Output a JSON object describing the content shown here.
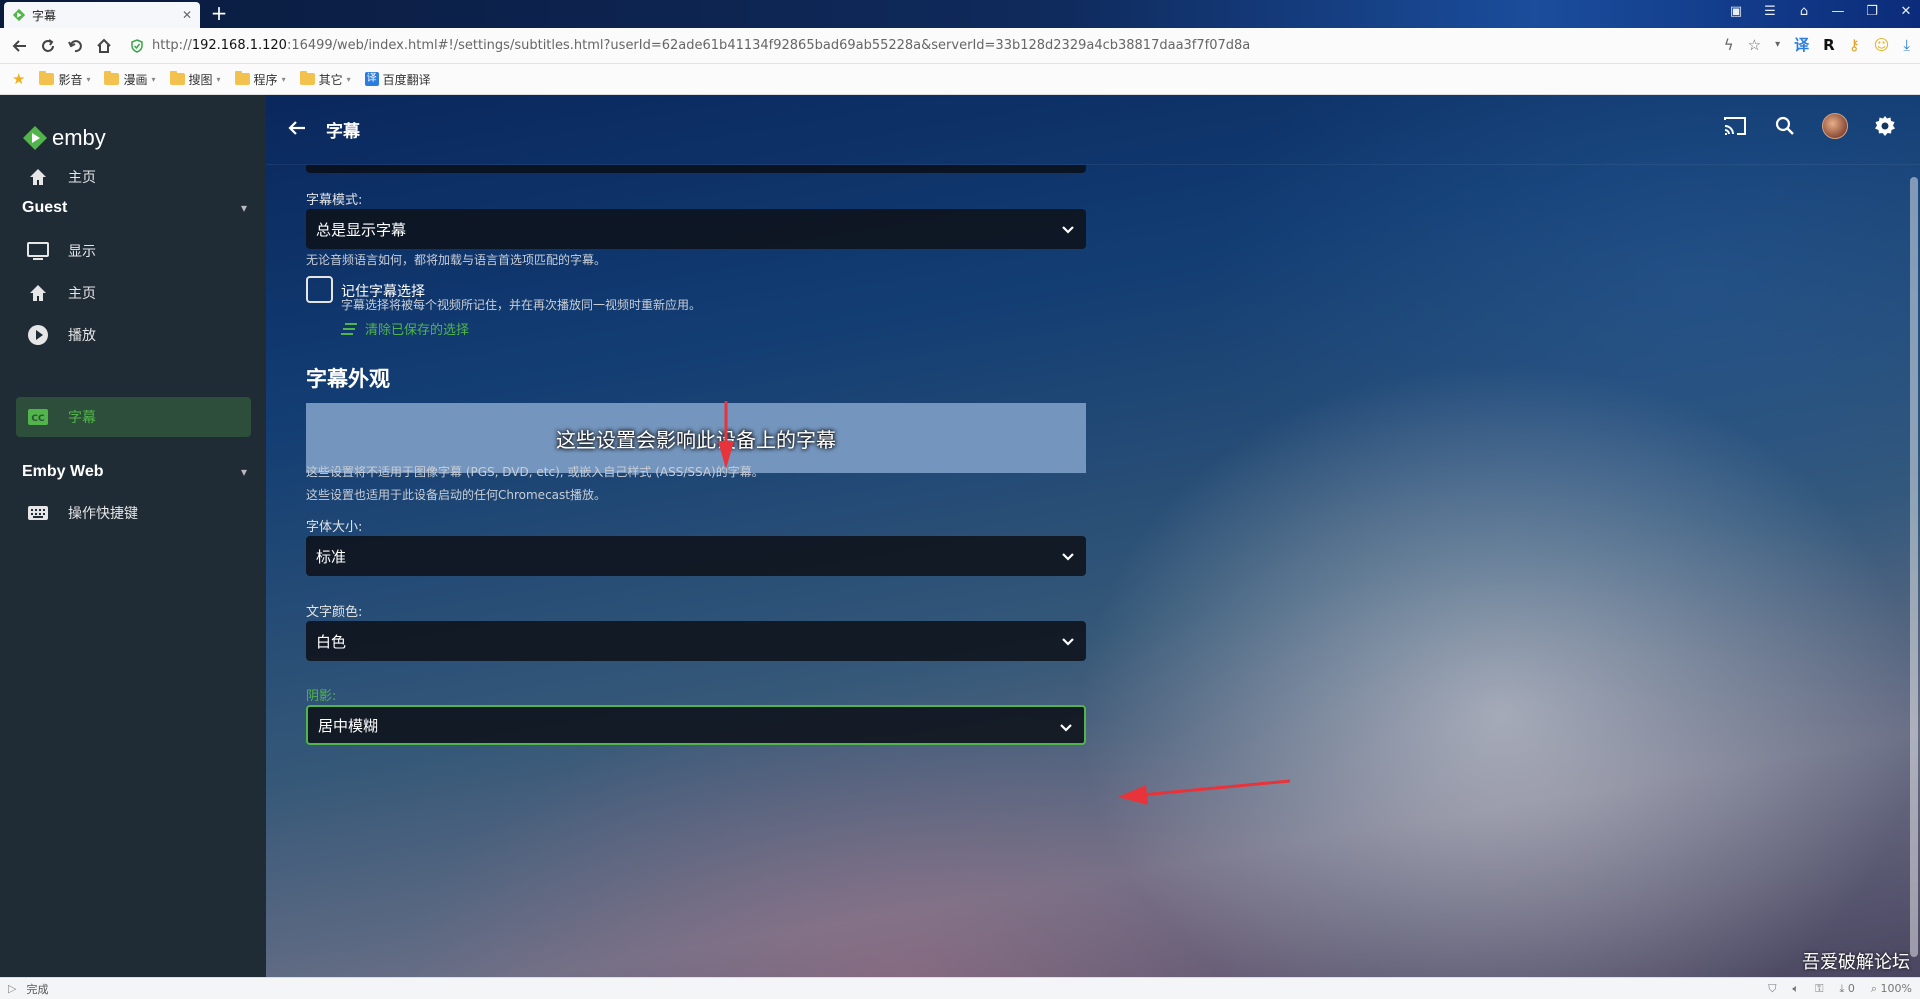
{
  "browser": {
    "tab_title": "字幕",
    "url_prefix": "http://",
    "url_host": "192.168.1.120",
    "url_rest": ":16499/web/index.html#!/settings/subtitles.html?userId=62ade61b41134f92865bad69ab55228a&serverId=33b128d2329a4cb38817daa3f7f07d8a",
    "bookmarks": [
      {
        "label": "影音",
        "type": "folder"
      },
      {
        "label": "漫画",
        "type": "folder"
      },
      {
        "label": "搜图",
        "type": "folder"
      },
      {
        "label": "程序",
        "type": "folder"
      },
      {
        "label": "其它",
        "type": "folder"
      },
      {
        "label": "百度翻译",
        "type": "link"
      }
    ],
    "status_text": "完成",
    "zoom": "100%",
    "download_count": "0"
  },
  "sidebar": {
    "logo": "emby",
    "home_label": "主页",
    "sections": [
      {
        "title": "Guest",
        "items": [
          "显示",
          "主页",
          "播放",
          "字幕"
        ]
      },
      {
        "title": "Emby Web",
        "items": [
          "操作快捷键"
        ]
      }
    ],
    "active_item": "字幕"
  },
  "header": {
    "title": "字幕"
  },
  "form": {
    "subtitle_mode": {
      "label": "字幕模式:",
      "value": "总是显示字幕",
      "help": "无论音频语言如何，都将加载与语言首选项匹配的字幕。"
    },
    "remember": {
      "label": "记住字幕选择",
      "help": "字幕选择将被每个视频所记住，并在再次播放同一视频时重新应用。",
      "clear_label": "清除已保存的选择",
      "checked": false
    },
    "appearance": {
      "title": "字幕外观",
      "preview_text": "这些设置会影响此设备上的字幕",
      "help_line1": "这些设置将不适用于图像字幕 (PGS, DVD, etc), 或嵌入自己样式 (ASS/SSA)的字幕。",
      "help_line2": "这些设置也适用于此设备启动的任何Chromecast播放。"
    },
    "font_size": {
      "label": "字体大小:",
      "value": "标准"
    },
    "text_color": {
      "label": "文字颜色:",
      "value": "白色"
    },
    "shadow": {
      "label": "阴影:",
      "value": "居中模糊",
      "focused": true
    }
  },
  "watermark": "吾爱破解论坛",
  "colors": {
    "accent": "#52b54b",
    "sidebar_bg": "#1f2b35",
    "preview_bg": "#7495bd",
    "arrow_red": "#e8333a"
  }
}
